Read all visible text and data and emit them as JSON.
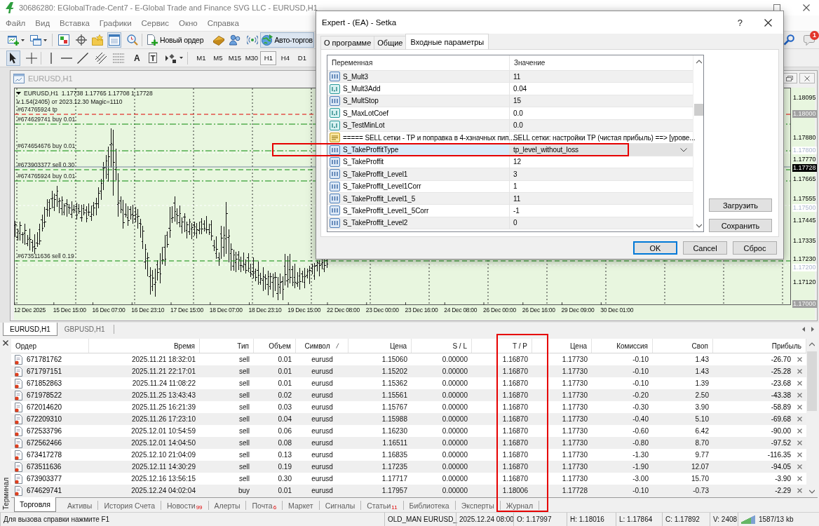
{
  "window": {
    "title": "30686280: EGlobalTrade-Cent7 - E-Global Trade and Finance SVG LLC - EURUSD,H1"
  },
  "menu": [
    "Файл",
    "Вид",
    "Вставка",
    "Графики",
    "Сервис",
    "Окно",
    "Справка"
  ],
  "toolbar": {
    "terminal_pressed": true,
    "new_order": "Новый ордер",
    "auto_trading": "Авто-торгов",
    "auto_trading_pressed": true,
    "notifications": "1"
  },
  "drawing_toolbar": {
    "cursor_pressed": true,
    "text_tool": "A",
    "label_tool": "T",
    "timeframes": [
      {
        "label": "M1",
        "selected": false
      },
      {
        "label": "M5",
        "selected": false
      },
      {
        "label": "M15",
        "selected": false
      },
      {
        "label": "M30",
        "selected": false
      },
      {
        "label": "H1",
        "selected": true
      },
      {
        "label": "H4",
        "selected": false
      },
      {
        "label": "D1",
        "selected": false
      }
    ]
  },
  "chart_window": {
    "title": "EURUSD,H1"
  },
  "chart": {
    "symbol_info": "EURUSD,H1  1.17738 1.17765 1.17708 1.17728",
    "expert_info": "v.1.54(2405) от 2023.12.30 Magic=1110",
    "order_lines": [
      {
        "label": "#674765924 tp",
        "kind": "tp"
      },
      {
        "label": "#674629741 buy 0.01",
        "kind": "buy"
      },
      {
        "label": "#674654676 buy 0.01",
        "kind": "buy"
      },
      {
        "label": "#673903377 sell 0.30",
        "kind": "sell"
      },
      {
        "label": "#674765924 buy 0.01",
        "kind": "buy"
      },
      {
        "label": "#673511636 sell 0.19",
        "kind": "sell"
      }
    ],
    "price_labels": [
      {
        "text": "1.18095",
        "kind": "tick"
      },
      {
        "text": "1.18000",
        "kind": "marker"
      },
      {
        "text": "1.17880",
        "kind": "tick"
      },
      {
        "text": "1.17800",
        "kind": "level"
      },
      {
        "text": "1.17770",
        "kind": "tick"
      },
      {
        "text": "1.17728",
        "kind": "bid"
      },
      {
        "text": "1.17665",
        "kind": "tick"
      },
      {
        "text": "1.17555",
        "kind": "tick"
      },
      {
        "text": "1.17500",
        "kind": "level"
      },
      {
        "text": "1.17445",
        "kind": "tick"
      },
      {
        "text": "1.17335",
        "kind": "tick"
      },
      {
        "text": "1.17230",
        "kind": "tick"
      },
      {
        "text": "1.17200",
        "kind": "level"
      },
      {
        "text": "1.17120",
        "kind": "tick"
      },
      {
        "text": "1.17000",
        "kind": "marker"
      }
    ],
    "time_labels": [
      "12 Dec 2025",
      "15 Dec 15:00",
      "16 Dec 07:00",
      "16 Dec 23:10",
      "17 Dec 15:00",
      "18 Dec 07:00",
      "18 Dec 23:10",
      "19 Dec 15:00",
      "22 Dec 08:00",
      "23 Dec 00:00",
      "23 Dec 16:00",
      "24 Dec 08:00",
      "26 Dec 00:00",
      "26 Dec 16:00",
      "29 Dec 09:00",
      "30 Dec 01:00"
    ]
  },
  "chart_tabs": [
    {
      "label": "EURUSD,H1",
      "selected": true
    },
    {
      "label": "GBPUSD,H1",
      "selected": false
    }
  ],
  "terminal": {
    "title": "Терминал",
    "columns": [
      {
        "label": "Ордер",
        "sorted": false,
        "highlighted": false
      },
      {
        "label": "Время",
        "sorted": false,
        "highlighted": false
      },
      {
        "label": "Тип",
        "sorted": false,
        "highlighted": false
      },
      {
        "label": "Объем",
        "sorted": false,
        "highlighted": false
      },
      {
        "label": "Символ",
        "sorted": true,
        "highlighted": false
      },
      {
        "label": "Цена",
        "sorted": false,
        "highlighted": false
      },
      {
        "label": "S / L",
        "sorted": false,
        "highlighted": false
      },
      {
        "label": "T / P",
        "sorted": false,
        "highlighted": true
      },
      {
        "label": "Цена",
        "sorted": false,
        "highlighted": false
      },
      {
        "label": "Комиссия",
        "sorted": false,
        "highlighted": false
      },
      {
        "label": "Своп",
        "sorted": false,
        "highlighted": false
      },
      {
        "label": "Прибыль",
        "sorted": false,
        "highlighted": false
      }
    ],
    "rows": [
      [
        "671781762",
        "2025.11.21 18:32:01",
        "sell",
        "0.01",
        "eurusd",
        "1.15060",
        "0.00000",
        "1.16870",
        "1.17730",
        "-0.10",
        "1.43",
        "-26.70"
      ],
      [
        "671797151",
        "2025.11.21 22:17:01",
        "sell",
        "0.01",
        "eurusd",
        "1.15202",
        "0.00000",
        "1.16870",
        "1.17730",
        "-0.10",
        "1.43",
        "-25.28"
      ],
      [
        "671852863",
        "2025.11.24 11:08:22",
        "sell",
        "0.01",
        "eurusd",
        "1.15362",
        "0.00000",
        "1.16870",
        "1.17730",
        "-0.10",
        "1.39",
        "-23.68"
      ],
      [
        "671978522",
        "2025.11.25 13:43:43",
        "sell",
        "0.02",
        "eurusd",
        "1.15561",
        "0.00000",
        "1.16870",
        "1.17730",
        "-0.20",
        "2.50",
        "-43.38"
      ],
      [
        "672014620",
        "2025.11.25 16:21:39",
        "sell",
        "0.03",
        "eurusd",
        "1.15767",
        "0.00000",
        "1.16870",
        "1.17730",
        "-0.30",
        "3.90",
        "-58.89"
      ],
      [
        "672209310",
        "2025.11.26 17:23:10",
        "sell",
        "0.04",
        "eurusd",
        "1.15988",
        "0.00000",
        "1.16870",
        "1.17730",
        "-0.40",
        "5.10",
        "-69.68"
      ],
      [
        "672533796",
        "2025.12.01 10:54:59",
        "sell",
        "0.06",
        "eurusd",
        "1.16230",
        "0.00000",
        "1.16870",
        "1.17730",
        "-0.60",
        "6.42",
        "-90.00"
      ],
      [
        "672562466",
        "2025.12.01 14:04:50",
        "sell",
        "0.08",
        "eurusd",
        "1.16511",
        "0.00000",
        "1.16870",
        "1.17730",
        "-0.80",
        "8.70",
        "-97.52"
      ],
      [
        "673417278",
        "2025.12.10 21:04:09",
        "sell",
        "0.13",
        "eurusd",
        "1.16835",
        "0.00000",
        "1.16870",
        "1.17730",
        "-1.30",
        "9.77",
        "-116.35"
      ],
      [
        "673511636",
        "2025.12.11 14:30:29",
        "sell",
        "0.19",
        "eurusd",
        "1.17235",
        "0.00000",
        "1.16870",
        "1.17730",
        "-1.90",
        "12.07",
        "-94.05"
      ],
      [
        "673903377",
        "2025.12.16 13:56:15",
        "sell",
        "0.30",
        "eurusd",
        "1.17717",
        "0.00000",
        "1.16870",
        "1.17730",
        "-3.00",
        "15.70",
        "-3.90"
      ],
      [
        "674629741",
        "2025.12.24 04:02:04",
        "buy",
        "0.01",
        "eurusd",
        "1.17957",
        "0.00000",
        "1.18006",
        "1.17728",
        "-0.10",
        "-0.73",
        "-2.29"
      ]
    ],
    "tabs": [
      {
        "label": "Торговля",
        "selected": true
      },
      {
        "label": "Активы",
        "selected": false
      },
      {
        "label": "История Счета",
        "selected": false
      },
      {
        "label": "Новости",
        "count": "99",
        "selected": false
      },
      {
        "label": "Алерты",
        "selected": false
      },
      {
        "label": "Почта",
        "count": "6",
        "selected": false
      },
      {
        "label": "Маркет",
        "selected": false
      },
      {
        "label": "Сигналы",
        "selected": false
      },
      {
        "label": "Статьи",
        "count": "11",
        "selected": false
      },
      {
        "label": "Библиотека",
        "selected": false
      },
      {
        "label": "Эксперты",
        "selected": false
      },
      {
        "label": "Журнал",
        "selected": false
      }
    ]
  },
  "status_bar": {
    "help": "Для вызова справки нажмите F1",
    "profile": "OLD_MAN EURUSD_",
    "time": "2025.12.24 08:00",
    "open": "O: 1.17997",
    "high": "H: 1.18016",
    "low": "L: 1.17864",
    "close": "C: 1.17892",
    "volume": "V: 2408",
    "traffic": "1587/13 kb"
  },
  "dialog": {
    "title": "Expert - (EA) - Setka",
    "help": "?",
    "tabs": [
      {
        "label": "О программе",
        "selected": false
      },
      {
        "label": "Общие",
        "selected": false
      },
      {
        "label": "Входные параметры",
        "selected": true
      }
    ],
    "columns": [
      "Переменная",
      "Значение"
    ],
    "params": [
      {
        "name": "S_Mult3",
        "value": "11",
        "kind": "int",
        "selected": false,
        "highlighted": false
      },
      {
        "name": "S_Mult3Add",
        "value": "0.04",
        "kind": "double",
        "selected": false,
        "highlighted": false
      },
      {
        "name": "S_MultStop",
        "value": "15",
        "kind": "int",
        "selected": false,
        "highlighted": false
      },
      {
        "name": "S_MaxLotCoef",
        "value": "0.0",
        "kind": "double",
        "selected": false,
        "highlighted": false
      },
      {
        "name": "S_TestMinLot",
        "value": "0.0",
        "kind": "double",
        "selected": false,
        "highlighted": false
      },
      {
        "name": "===== SELL сетки - TP и поправка в 4-хзначных пип...",
        "value": "SELL сетки: настройки TP (чистая прибыль) ==> [урове...",
        "kind": "string",
        "selected": false,
        "highlighted": false
      },
      {
        "name": "S_TakeProffitType",
        "value": "tp_level_without_loss",
        "kind": "int",
        "selected": true,
        "highlighted": true
      },
      {
        "name": "S_TakeProffit",
        "value": "12",
        "kind": "int",
        "selected": false,
        "highlighted": false
      },
      {
        "name": "S_TakeProffit_Level1",
        "value": "3",
        "kind": "int",
        "selected": false,
        "highlighted": false
      },
      {
        "name": "S_TakeProffit_Level1Corr",
        "value": "1",
        "kind": "int",
        "selected": false,
        "highlighted": false
      },
      {
        "name": "S_TakeProffit_Level1_5",
        "value": "11",
        "kind": "int",
        "selected": false,
        "highlighted": false
      },
      {
        "name": "S_TakeProffit_Level1_5Corr",
        "value": "-1",
        "kind": "int",
        "selected": false,
        "highlighted": false
      },
      {
        "name": "S_TakeProffit_Level2",
        "value": "0",
        "kind": "int",
        "selected": false,
        "highlighted": false
      }
    ],
    "side_buttons": [
      "Загрузить",
      "Сохранить"
    ],
    "buttons": [
      {
        "label": "OK",
        "default": true
      },
      {
        "label": "Cancel",
        "default": false
      },
      {
        "label": "Сброс",
        "default": false
      }
    ]
  }
}
